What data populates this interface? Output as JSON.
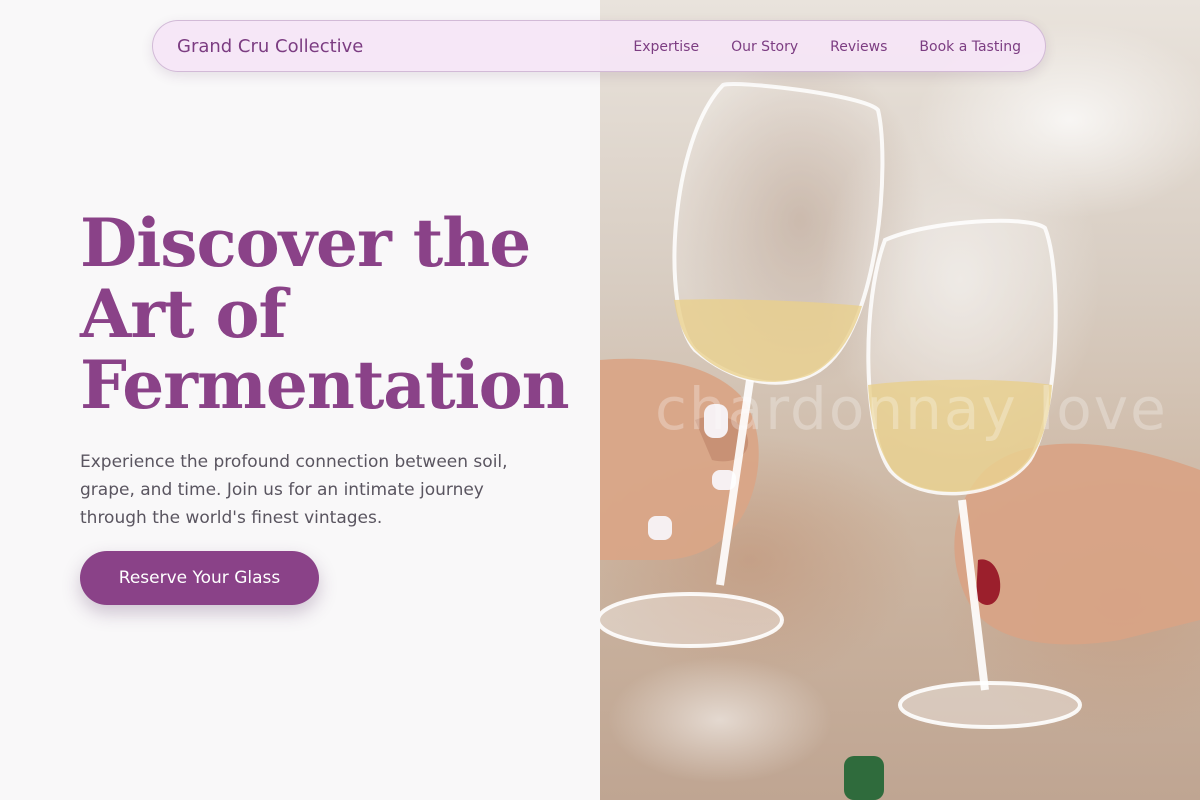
{
  "brand": "Grand Cru Collective",
  "nav": {
    "links": [
      "Expertise",
      "Our Story",
      "Reviews",
      "Book a Tasting"
    ]
  },
  "hero": {
    "title_lines": [
      "Discover the",
      "Art of",
      "Fermentation"
    ],
    "subtitle": "Experience the profound connection between soil, grape, and time. Join us for an intimate journey through the world's finest vintages.",
    "cta_label": "Reserve Your Glass"
  },
  "image": {
    "watermark": "chardonnay love"
  },
  "colors": {
    "accent": "#8a4288",
    "nav_bg": "#f5e5f6",
    "text_muted": "#5a5560",
    "page_bg": "#f9f8f9"
  }
}
